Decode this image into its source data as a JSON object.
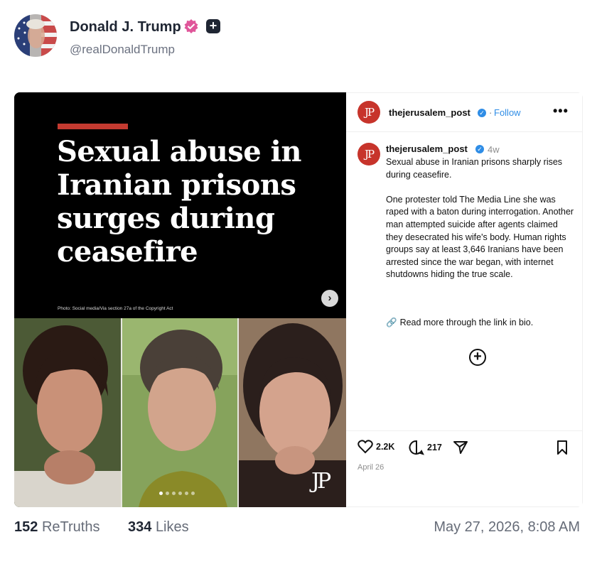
{
  "post": {
    "author_name": "Donald J. Trump",
    "author_handle": "@realDonaldTrump",
    "retruths_count": "152",
    "retruths_label": "ReTruths",
    "likes_count": "334",
    "likes_label": "Likes",
    "timestamp": "May 27, 2026, 8:08 AM"
  },
  "media": {
    "headline": "Sexual abuse in Iranian prisons surges during ceasefire",
    "photo_credit": "Photo: Social media/Via section 27a of the Copyright Act",
    "watermark": "JP",
    "carousel_dots": 6,
    "active_dot": 1
  },
  "instagram": {
    "logo": "JP",
    "username": "thejerusalem_post",
    "follow_label": "Follow",
    "separator": "·",
    "more_label": "•••",
    "age": "4w",
    "caption_title": "Sexual abuse in Iranian prisons sharply rises during ceasefire.",
    "caption_body": "One protester told The Media Line she was raped with a baton during interrogation. Another man attempted suicide after agents claimed they desecrated his wife's body. Human rights groups say at least 3,646 Iranians have been arrested since the war began, with internet shutdowns hiding the true scale.",
    "read_more": "Read more through the link in bio.",
    "add_icon": "+",
    "likes": "2.2K",
    "comments": "217",
    "date": "April 26"
  },
  "colors": {
    "accent_red": "#c33a30",
    "ig_blue": "#2f8de6",
    "verified_pink": "#e0569a"
  },
  "icons": [
    "avatar-image",
    "verified-badge-icon",
    "plus-badge-icon",
    "next-arrow-icon",
    "link-icon",
    "add-circle-icon",
    "heart-icon",
    "comment-icon",
    "share-icon",
    "bookmark-icon"
  ]
}
